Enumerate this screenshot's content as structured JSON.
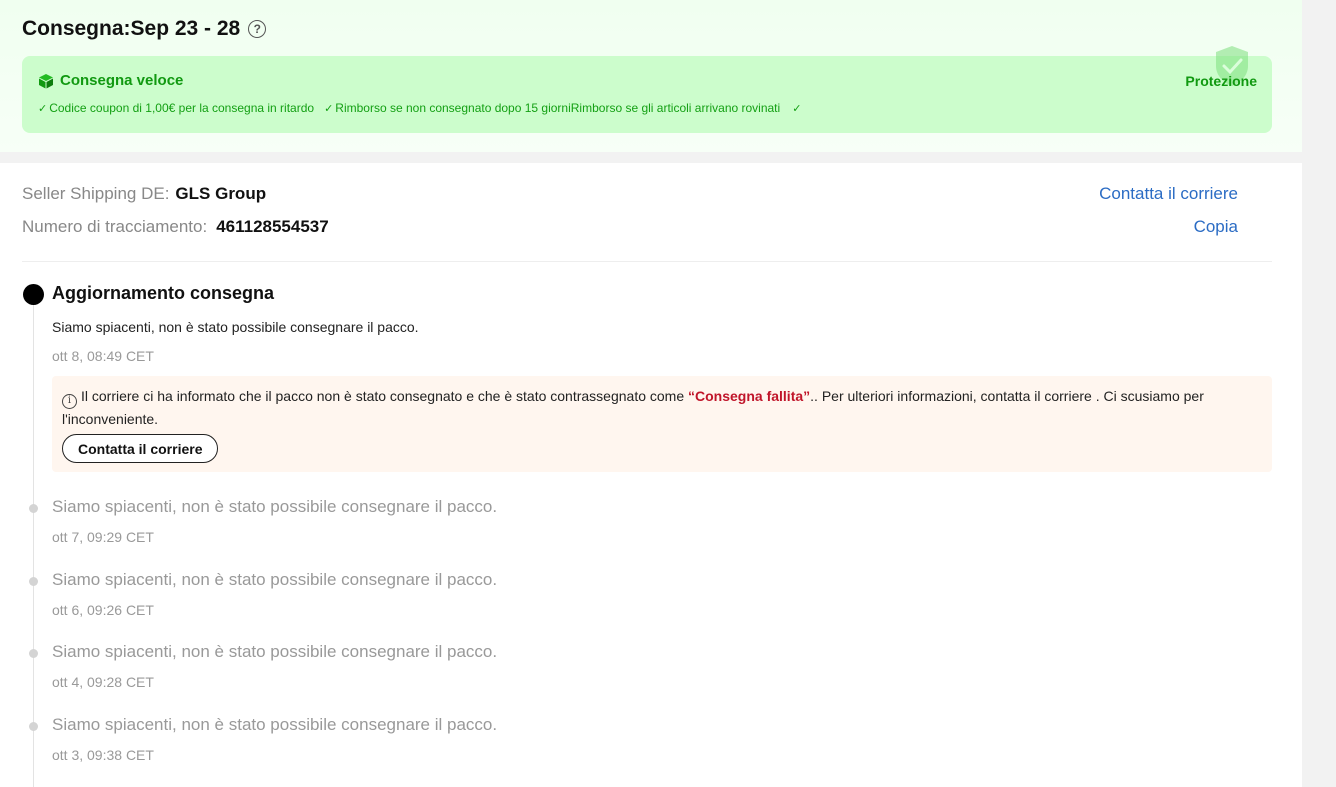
{
  "delivery": {
    "title": "Consegna:Sep 23 - 28",
    "help_icon": "?"
  },
  "protection_box": {
    "fast_label": "Consegna veloce",
    "protection_label": "Protezione",
    "benefits": [
      "Codice coupon di 1,00€ per la consegna in ritardo",
      "Rimborso se non consegnato dopo 15 giorniRimborso se gli articoli arrivano rovinati",
      ""
    ],
    "colors": {
      "background": "#ccfdcc",
      "text": "#119911"
    }
  },
  "shipping": {
    "carrier_label": "Seller Shipping DE:",
    "carrier_value": "GLS Group",
    "tracking_label": "Numero di tracciamento:",
    "tracking_value": "461128554537",
    "contact_link": "Contatta il corriere",
    "copy_link": "Copia"
  },
  "latest_update": {
    "title": "Aggiornamento consegna",
    "description": "Siamo spiacenti, non è stato possibile consegnare il pacco.",
    "time": "ott 8, 08:49 CET",
    "alert": {
      "text_before": "Il corriere ci ha informato che il pacco non è stato consegnato e che è stato contrassegnato come ",
      "highlight": "“Consegna fallita”",
      "text_after": ".. Per ulteriori informazioni, contatta il corriere . Ci scusiamo per l'inconveniente.",
      "button_label": "Contatta il corriere"
    }
  },
  "history": [
    {
      "description": "Siamo spiacenti, non è stato possibile consegnare il pacco.",
      "time": "ott 7, 09:29 CET"
    },
    {
      "description": "Siamo spiacenti, non è stato possibile consegnare il pacco.",
      "time": "ott 6, 09:26 CET"
    },
    {
      "description": "Siamo spiacenti, non è stato possibile consegnare il pacco.",
      "time": "ott 4, 09:28 CET"
    },
    {
      "description": "Siamo spiacenti, non è stato possibile consegnare il pacco.",
      "time": "ott 3, 09:38 CET"
    }
  ]
}
